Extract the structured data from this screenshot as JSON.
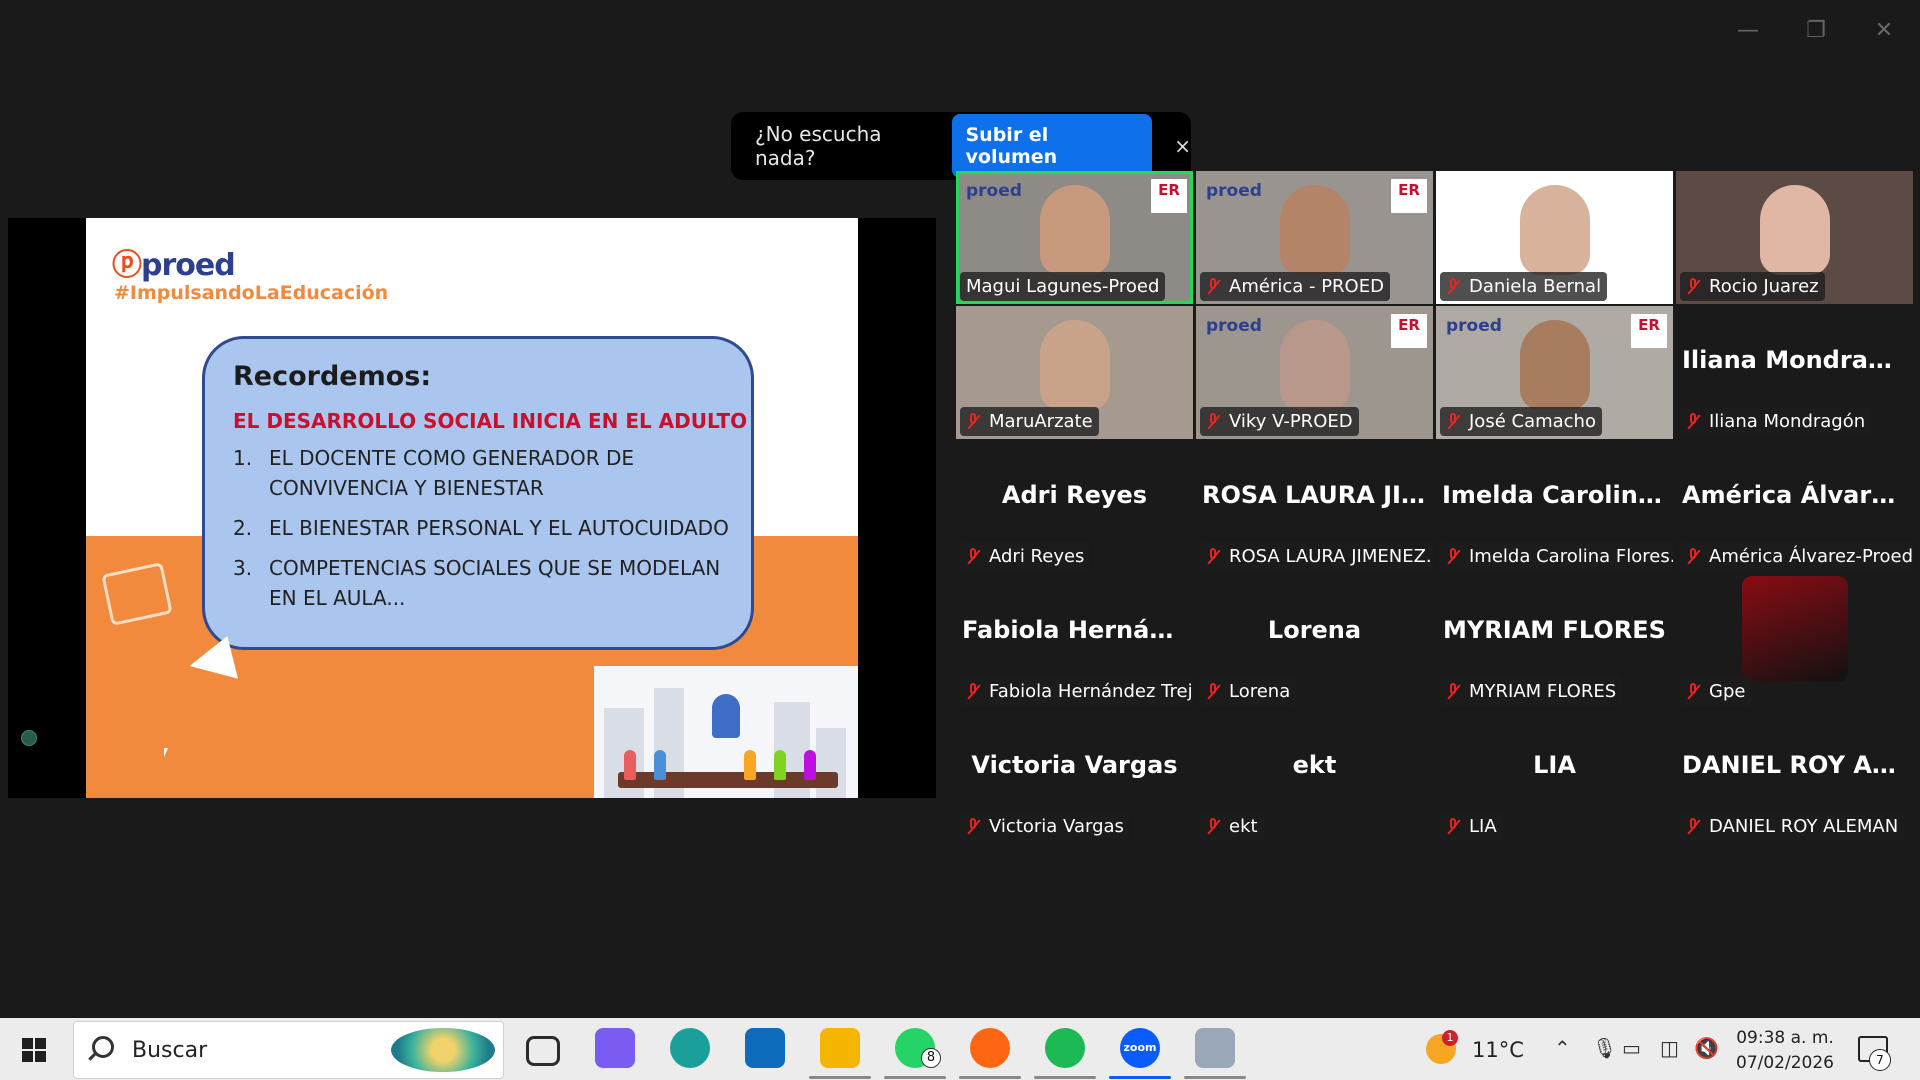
{
  "window": {
    "minimize": "—",
    "maximize": "❐",
    "close": "✕"
  },
  "toast": {
    "question": "¿No escucha nada?",
    "button": "Subir el volumen",
    "close": "×"
  },
  "slide": {
    "logo_prefix": "ⓟ",
    "logo": "proed",
    "hashtag": "#ImpulsandoLaEducación",
    "heading": "Recordemos:",
    "subheading": "EL DESARROLLO SOCIAL INICIA EN EL ADULTO",
    "items": [
      {
        "n": "1.",
        "text": "EL DOCENTE COMO GENERADOR DE CONVIVENCIA Y BIENESTAR"
      },
      {
        "n": "2.",
        "text": "EL BIENESTAR PERSONAL Y EL AUTOCUIDADO"
      },
      {
        "n": "3.",
        "text": "COMPETENCIAS SOCIALES QUE SE MODELAN EN EL AULA..."
      }
    ]
  },
  "participants": [
    {
      "label": "Magui Lagunes-Proed",
      "video": true,
      "muted": false,
      "active": true,
      "brand": "proed",
      "er": "ER"
    },
    {
      "label": "América - PROED",
      "video": true,
      "muted": true,
      "brand": "proed",
      "er": "ER"
    },
    {
      "label": "Daniela Bernal",
      "video": true,
      "muted": true
    },
    {
      "label": "Rocio Juarez",
      "video": true,
      "muted": true
    },
    {
      "label": "MaruArzate",
      "video": true,
      "muted": true
    },
    {
      "label": "Viky V-PROED",
      "video": true,
      "muted": true,
      "brand": "proed",
      "er": "ER"
    },
    {
      "label": "José Camacho",
      "video": true,
      "muted": true,
      "brand": "proed",
      "er": "ER"
    },
    {
      "big": "Iliana Mondragón",
      "label": "Iliana Mondragón",
      "muted": true
    },
    {
      "big": "Adri Reyes",
      "label": "Adri Reyes",
      "muted": true
    },
    {
      "big": "ROSA LAURA JI...",
      "label": "ROSA LAURA JIMENEZ...",
      "muted": true
    },
    {
      "big": "Imelda Carolina...",
      "label": "Imelda Carolina Flores...",
      "muted": true
    },
    {
      "big": "América Álvare...",
      "label": "América Álvarez-Proed",
      "muted": true
    },
    {
      "big": "Fabiola Hernán...",
      "label": "Fabiola Hernández Trejo",
      "muted": true
    },
    {
      "big": "Lorena",
      "label": "Lorena",
      "muted": true
    },
    {
      "big": "MYRIAM FLORES",
      "label": "MYRIAM FLORES",
      "muted": true
    },
    {
      "label": "Gpe",
      "muted": true,
      "avatar": true
    },
    {
      "big": "Victoria Vargas",
      "label": "Victoria Vargas",
      "muted": true
    },
    {
      "big": "ekt",
      "label": "ekt",
      "muted": true
    },
    {
      "big": "LIA",
      "label": "LIA",
      "muted": true
    },
    {
      "big": "DANIEL ROY AL...",
      "label": "DANIEL ROY ALEMAN",
      "muted": true
    }
  ],
  "taskbar": {
    "search_placeholder": "Buscar",
    "apps": [
      {
        "name": "task-view-icon",
        "color": "#2b2b2b"
      },
      {
        "name": "copilot-icon",
        "color": "#7b5cf0"
      },
      {
        "name": "edge-icon",
        "color": "#1a9f9a"
      },
      {
        "name": "outlook-icon",
        "color": "#0f6cbd"
      },
      {
        "name": "file-explorer-icon",
        "color": "#f4b400"
      },
      {
        "name": "whatsapp-icon",
        "color": "#25d366",
        "badge": "8"
      },
      {
        "name": "firefox-icon",
        "color": "#ff6611"
      },
      {
        "name": "spotify-icon",
        "color": "#1db954"
      },
      {
        "name": "zoom-icon",
        "color": "#0b5cff",
        "text": "zoom"
      },
      {
        "name": "paint-icon",
        "color": "#9aa7b8"
      }
    ],
    "weather_badge": "1",
    "temperature": "11°C",
    "time": "09:38 a. m.",
    "date": "07/02/2026",
    "notifications": "7"
  }
}
